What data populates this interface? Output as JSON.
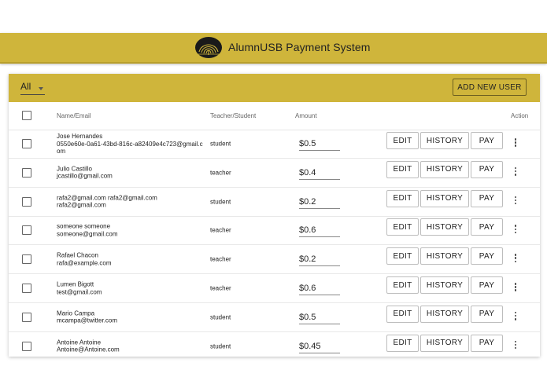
{
  "app": {
    "title": "AlumnUSB Payment System"
  },
  "toolbar": {
    "filter_value": "All",
    "add_user_label": "ADD NEW USER"
  },
  "table": {
    "headers": {
      "name_email": "Name/Email",
      "role": "Teacher/Student",
      "amount": "Amount",
      "action": "Action"
    },
    "actions": {
      "edit": "EDIT",
      "history": "HISTORY",
      "pay": "PAY"
    },
    "rows": [
      {
        "name": "Jose Hernandes",
        "email": "0550e60e-0a61-43bd-816c-a82409e4c723@gmail.com",
        "role": "student",
        "amount": "$0.5"
      },
      {
        "name": "Julio Castillo",
        "email": "jcastillo@gmail.com",
        "role": "teacher",
        "amount": "$0.4"
      },
      {
        "name": "rafa2@gmail.com rafa2@gmail.com",
        "email": "rafa2@gmail.com",
        "role": "student",
        "amount": "$0.2"
      },
      {
        "name": "someone someone",
        "email": "someone@gmail.com",
        "role": "teacher",
        "amount": "$0.6"
      },
      {
        "name": "Rafael Chacon",
        "email": "rafa@example.com",
        "role": "teacher",
        "amount": "$0.2"
      },
      {
        "name": "Lumen Bigott",
        "email": "test@gmail.com",
        "role": "teacher",
        "amount": "$0.6"
      },
      {
        "name": "Mario Campa",
        "email": "mcampa@twitter.com",
        "role": "student",
        "amount": "$0.5"
      },
      {
        "name": "Antoine Antoine",
        "email": "Antoine@Antoine.com",
        "role": "student",
        "amount": "$0.45"
      }
    ]
  },
  "icons": {
    "logo": "usb-logo-icon",
    "filter_caret": "caret-down-icon",
    "row_menu": "more-vert-icon"
  },
  "colors": {
    "brand": "#cfb53b"
  }
}
